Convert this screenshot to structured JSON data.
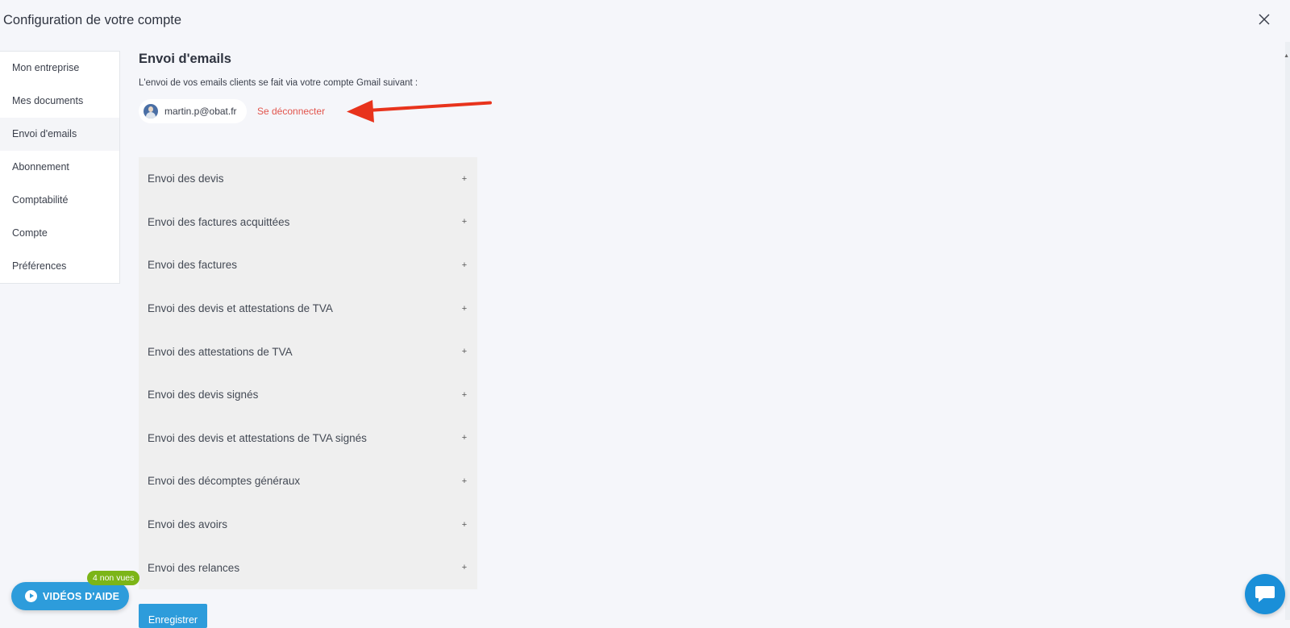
{
  "header": {
    "title": "Configuration de votre compte",
    "close_icon": "close-icon"
  },
  "sidebar": {
    "items": [
      {
        "label": "Mon entreprise"
      },
      {
        "label": "Mes documents"
      },
      {
        "label": "Envoi d'emails",
        "active": true
      },
      {
        "label": "Abonnement"
      },
      {
        "label": "Comptabilité"
      },
      {
        "label": "Compte"
      },
      {
        "label": "Préférences"
      }
    ]
  },
  "main": {
    "title": "Envoi d'emails",
    "description": "L'envoi de vos emails clients se fait via votre compte Gmail suivant :",
    "account": {
      "email": "martin.p@obat.fr",
      "logout_label": "Se déconnecter"
    },
    "accordion": [
      {
        "label": "Envoi des devis",
        "icon": "+"
      },
      {
        "label": "Envoi des factures acquittées",
        "icon": "+"
      },
      {
        "label": "Envoi des factures",
        "icon": "+"
      },
      {
        "label": "Envoi des devis et attestations de TVA",
        "icon": "+"
      },
      {
        "label": "Envoi des attestations de TVA",
        "icon": "+"
      },
      {
        "label": "Envoi des devis signés",
        "icon": "+"
      },
      {
        "label": "Envoi des devis et attestations de TVA signés",
        "icon": "+"
      },
      {
        "label": "Envoi des décomptes généraux",
        "icon": "+"
      },
      {
        "label": "Envoi des avoirs",
        "icon": "+"
      },
      {
        "label": "Envoi des relances",
        "icon": "+"
      }
    ],
    "save_label": "Enregistrer"
  },
  "help": {
    "videos_label": "VIDÉOS D'AIDE",
    "unseen_badge": "4 non vues"
  },
  "colors": {
    "accent": "#2d9cdb",
    "logout": "#e2554d",
    "arrow": "#e8331c",
    "badge": "#7cb518",
    "background": "#f5f6fa",
    "accordion_bg": "#efefef"
  }
}
